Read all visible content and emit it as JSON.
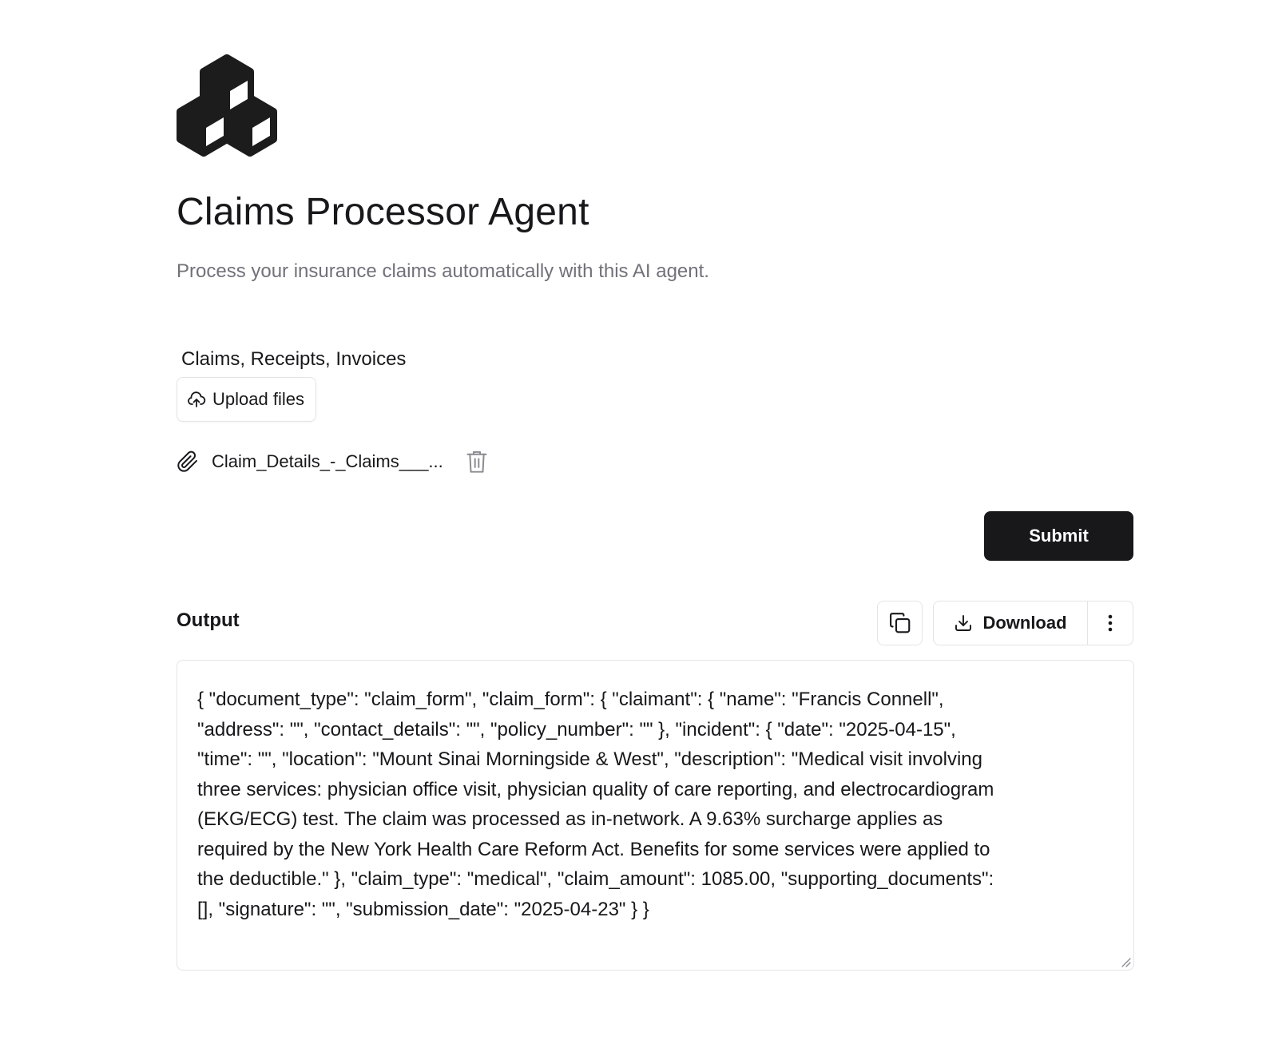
{
  "header": {
    "logo_icon": "hexagon-cubes-logo-icon",
    "title": "Claims Processor Agent",
    "subtitle": "Process your insurance claims automatically with this AI agent."
  },
  "upload": {
    "label": "Claims, Receipts, Invoices",
    "button_label": "Upload files",
    "button_icon": "cloud-upload-icon",
    "files": [
      {
        "name": "Claim_Details_-_Claims___...",
        "icon": "paperclip-icon",
        "delete_icon": "trash-icon"
      }
    ]
  },
  "actions": {
    "submit_label": "Submit"
  },
  "output": {
    "label": "Output",
    "copy_icon": "copy-icon",
    "download_label": "Download",
    "download_icon": "download-icon",
    "more_icon": "vertical-dots-icon",
    "text": "{ \"document_type\": \"claim_form\", \"claim_form\": { \"claimant\": { \"name\": \"Francis Connell\", \"address\": \"\", \"contact_details\": \"\", \"policy_number\": \"\" }, \"incident\": { \"date\": \"2025-04-15\", \"time\": \"\", \"location\": \"Mount Sinai Morningside & West\", \"description\": \"Medical visit involving three services: physician office visit, physician quality of care reporting, and electrocardiogram (EKG/ECG) test. The claim was processed as in-network. A 9.63% surcharge applies as required by the New York Health Care Reform Act. Benefits for some services were applied to the deductible.\" }, \"claim_type\": \"medical\", \"claim_amount\": 1085.00, \"supporting_documents\": [], \"signature\": \"\", \"submission_date\": \"2025-04-23\" } }"
  },
  "colors": {
    "primary": "#18181b",
    "muted_text": "#71717a",
    "border": "#e4e4e7",
    "background": "#ffffff"
  }
}
